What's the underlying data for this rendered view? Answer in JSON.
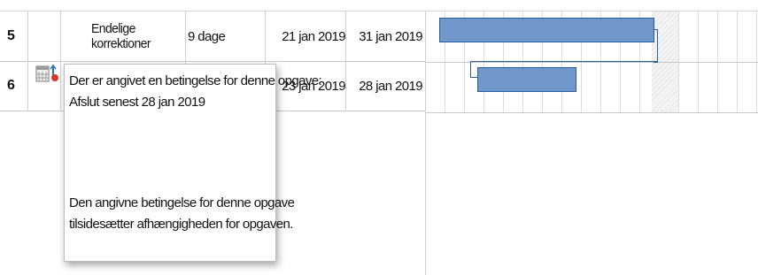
{
  "rows": [
    {
      "id": "5",
      "name": "Endelige korrektioner",
      "duration": "9 dage",
      "start": "21 jan 2019",
      "finish": "31 jan 2019"
    },
    {
      "id": "6",
      "name": "",
      "duration": "",
      "start": "23 jan 2019",
      "finish": "28 jan 2019"
    }
  ],
  "tooltip": {
    "line1": "Der er angivet en betingelse for denne opgave:",
    "line2": "Afslut senest 28 jan 2019",
    "line3": "Den angivne betingelse for denne opgave",
    "line4": "tilsidesætter afhængigheden for opgaven."
  },
  "icons": {
    "constraint": "calendar-constraint-icon"
  },
  "colors": {
    "bar_fill": "#6f97c9",
    "bar_border": "#2c5c99",
    "constraint_red": "#e0322a"
  }
}
